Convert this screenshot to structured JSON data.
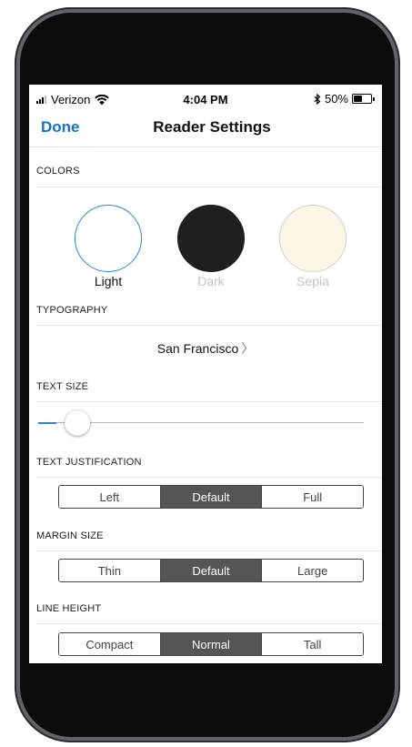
{
  "status_bar": {
    "carrier": "Verizon",
    "time": "4:04 PM",
    "bluetooth_icon": "bluetooth-icon",
    "battery_percent": "50%",
    "battery_level": 0.5
  },
  "nav": {
    "done_label": "Done",
    "title": "Reader Settings"
  },
  "colors": {
    "section_label": "COLORS",
    "options": [
      {
        "label": "Light",
        "fill": "#ffffff",
        "selected": true
      },
      {
        "label": "Dark",
        "fill": "#1f1f1f",
        "selected": false
      },
      {
        "label": "Sepia",
        "fill": "#fbf5e6",
        "selected": false
      }
    ],
    "accent": "#2a86d6"
  },
  "typography": {
    "section_label": "TYPOGRAPHY",
    "font_name": "San Francisco",
    "chevron": "〉"
  },
  "text_size": {
    "section_label": "TEXT SIZE",
    "value": 0.08
  },
  "text_justification": {
    "section_label": "TEXT JUSTIFICATION",
    "options": [
      "Left",
      "Default",
      "Full"
    ],
    "selected": "Default"
  },
  "margin_size": {
    "section_label": "MARGIN SIZE",
    "options": [
      "Thin",
      "Default",
      "Large"
    ],
    "selected": "Default"
  },
  "line_height": {
    "section_label": "LINE HEIGHT",
    "options": [
      "Compact",
      "Normal",
      "Tall"
    ],
    "selected": "Normal"
  }
}
